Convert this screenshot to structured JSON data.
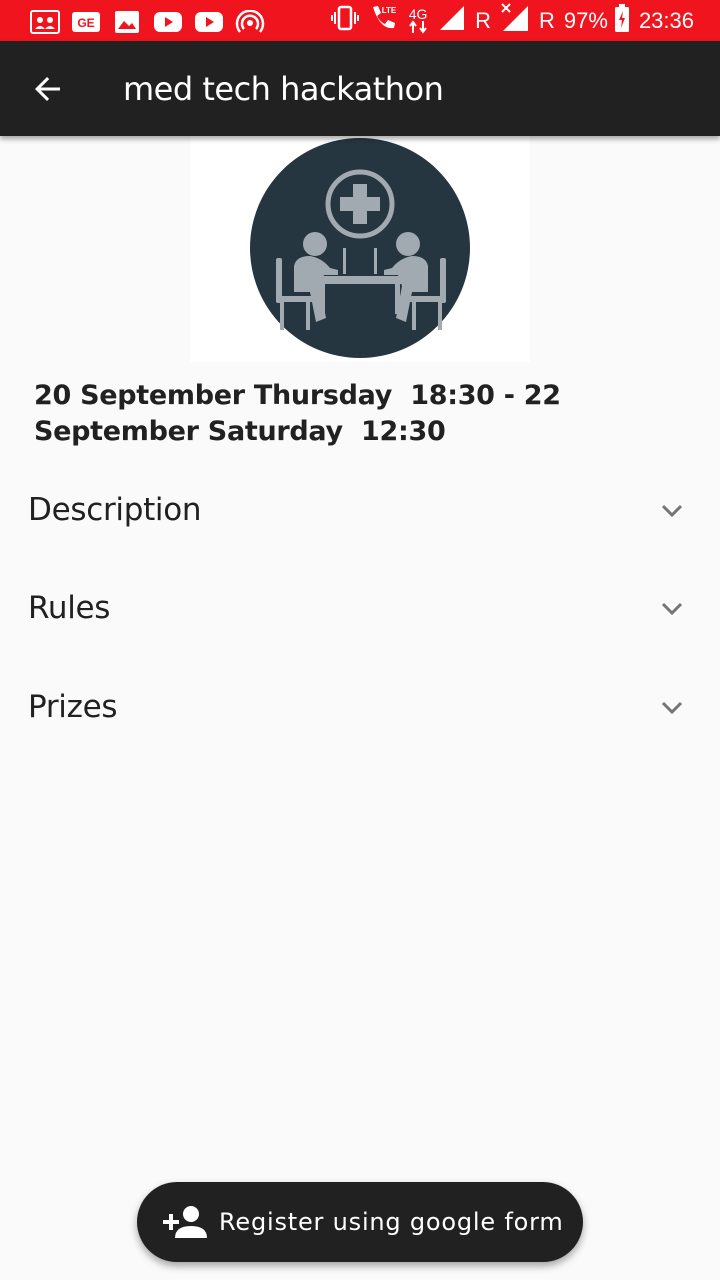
{
  "status_bar": {
    "roaming_1": "R",
    "roaming_2": "R",
    "battery": "97%",
    "time": "23:36",
    "network_type": "4G",
    "lte": "LTE",
    "color": "#f0141e"
  },
  "app_bar": {
    "title": "med tech hackathon",
    "back_icon": "arrow-back-icon",
    "color": "#212121"
  },
  "event": {
    "image_icon": "medical-hackathon-illustration",
    "date": "20 September Thursday  18:30 - 22 September Saturday  12:30"
  },
  "sections": [
    {
      "title": "Description",
      "icon": "chevron-down-icon"
    },
    {
      "title": "Rules",
      "icon": "chevron-down-icon"
    },
    {
      "title": "Prizes",
      "icon": "chevron-down-icon"
    }
  ],
  "fab": {
    "label": "Register using google form",
    "icon": "person-add-icon"
  }
}
